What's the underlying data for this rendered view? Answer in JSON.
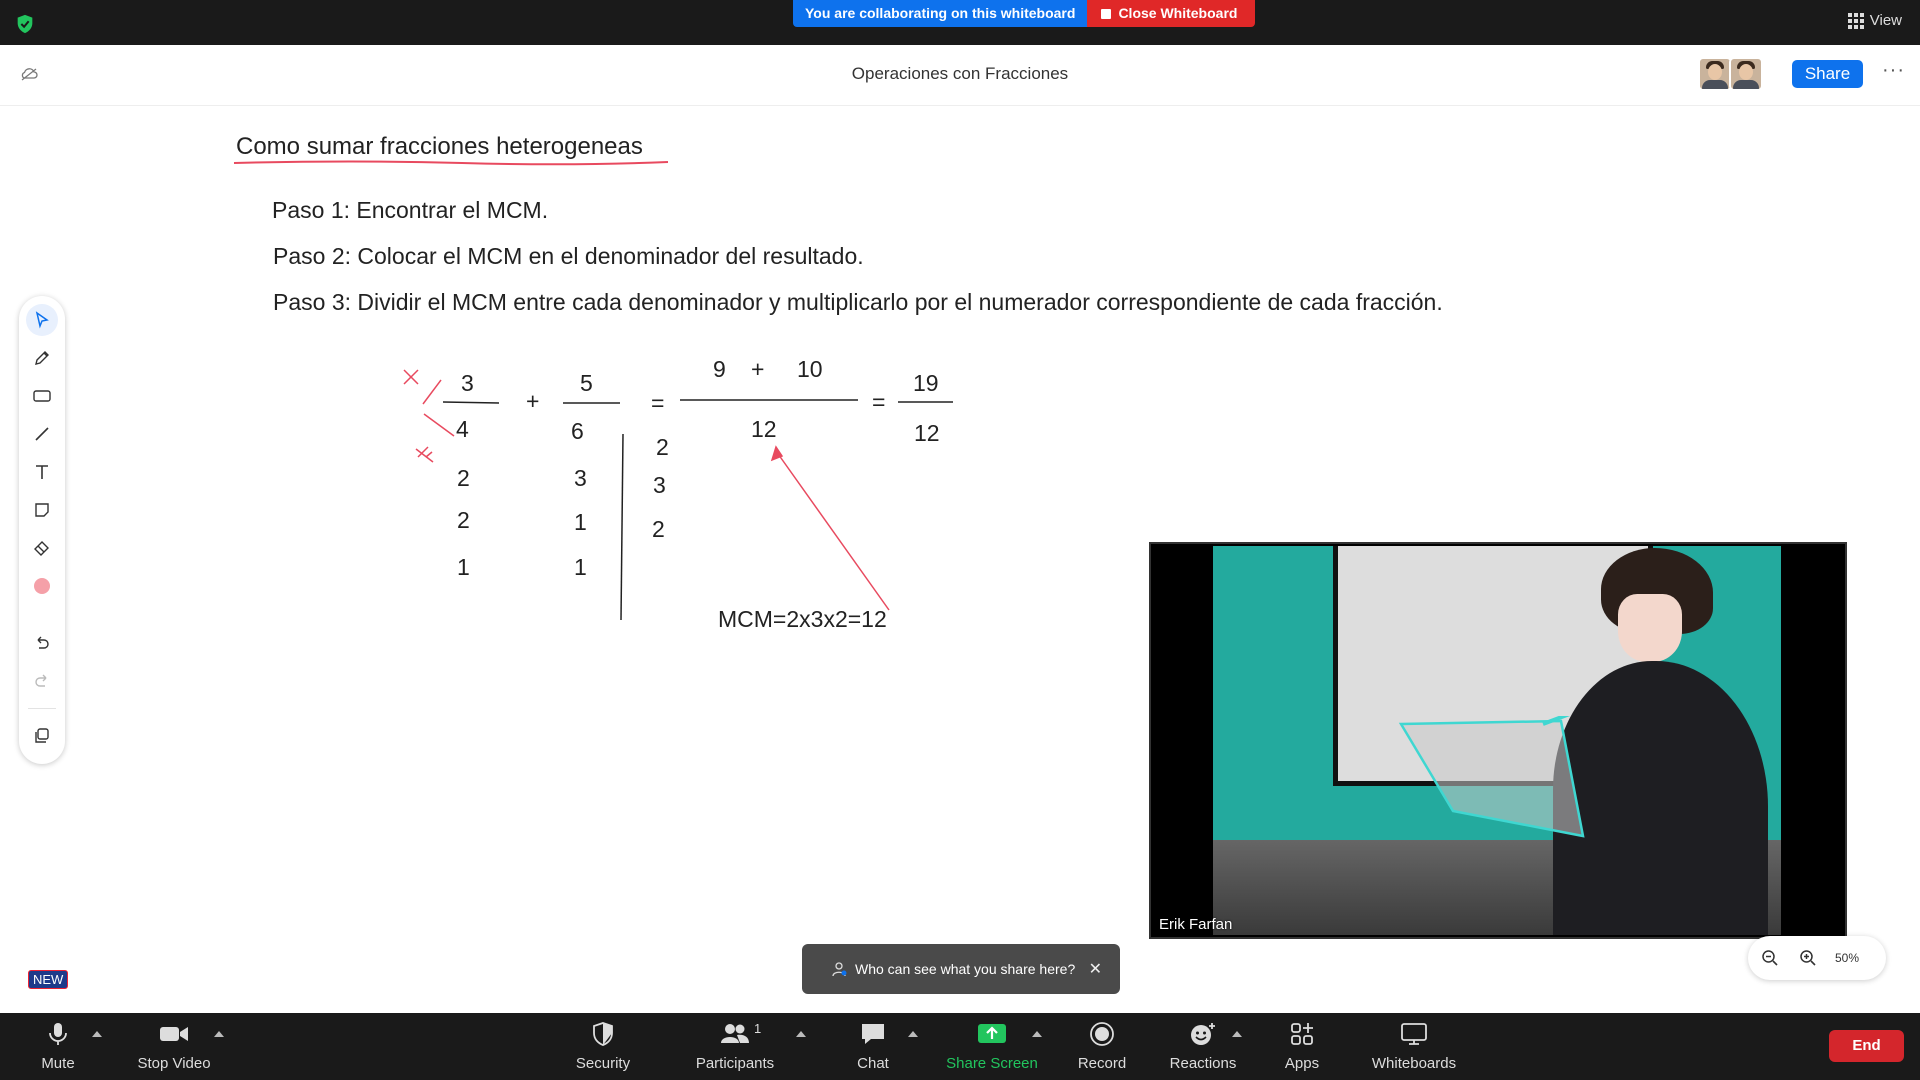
{
  "topbar": {
    "collab_info": "You are collaborating on this whiteboard",
    "close_whiteboard": "Close Whiteboard",
    "view_label": "View"
  },
  "header": {
    "title": "Operaciones con Fracciones",
    "share_label": "Share",
    "more_label": "···"
  },
  "whiteboard": {
    "heading": "Como sumar fracciones heterogeneas",
    "steps": [
      "Paso 1: Encontrar el MCM.",
      "Paso 2: Colocar el MCM en el denominador del resultado.",
      "Paso 3: Dividir el MCM entre cada denominador y multiplicarlo por el numerador correspondiente de cada fracción."
    ],
    "math": {
      "frac1_num": "3",
      "frac1_den": "4",
      "plus": "+",
      "frac2_num": "5",
      "frac2_den": "6",
      "equals": "=",
      "res_num_a": "9",
      "res_plus": "+",
      "res_num_b": "10",
      "res_den": "12",
      "equals2": "=",
      "final_num": "19",
      "final_den": "12",
      "col1": [
        "2",
        "2",
        "1"
      ],
      "col2": [
        "3",
        "1",
        "1"
      ],
      "divisors": [
        "2",
        "3",
        "2"
      ],
      "mcm_note": "MCM=2x3x2=12"
    },
    "accent_color": "#e84a5f"
  },
  "video": {
    "participant_name": "Erik Farfan"
  },
  "tooltip": {
    "text": "Who can see what you share here?"
  },
  "zoom": {
    "level": "50%"
  },
  "badge": {
    "new": "NEW"
  },
  "bottombar": {
    "mute": "Mute",
    "stop_video": "Stop Video",
    "security": "Security",
    "participants": "Participants",
    "participants_count": "1",
    "chat": "Chat",
    "share_screen": "Share Screen",
    "record": "Record",
    "reactions": "Reactions",
    "apps": "Apps",
    "whiteboards": "Whiteboards",
    "end": "End"
  },
  "colors": {
    "topbar_bg": "#1a1a1a",
    "blue": "#0e72ed",
    "red": "#e02828",
    "share_green": "#22c55e"
  }
}
